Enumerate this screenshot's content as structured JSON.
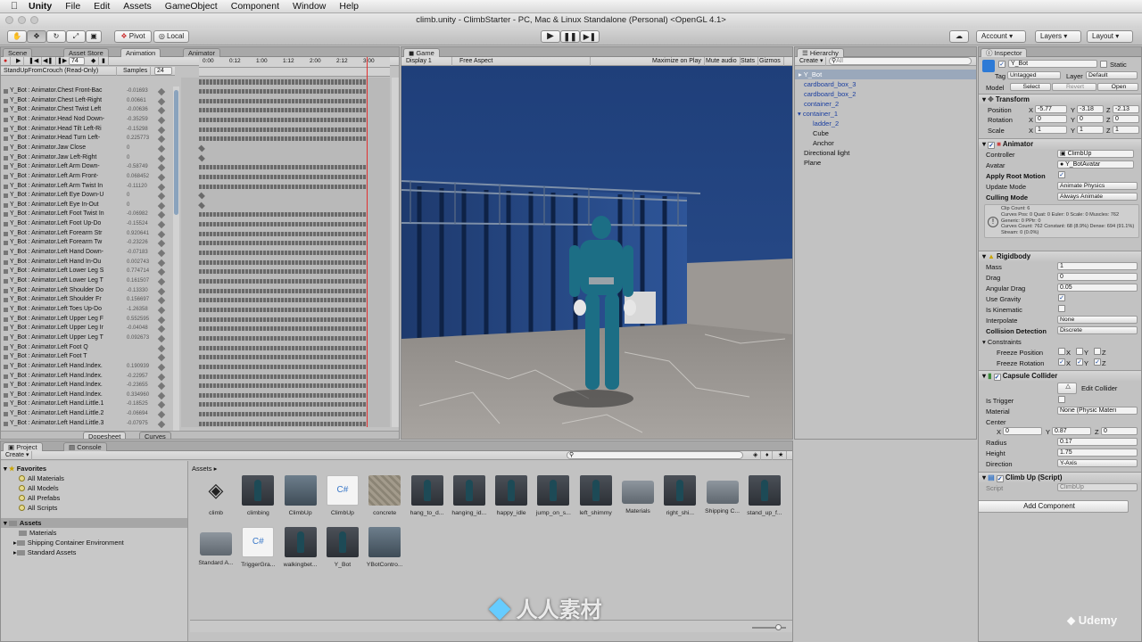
{
  "menubar": {
    "app": "Unity",
    "items": [
      "File",
      "Edit",
      "Assets",
      "GameObject",
      "Component",
      "Window",
      "Help"
    ]
  },
  "window": {
    "title": "climb.unity - ClimbStarter - PC, Mac & Linux Standalone (Personal) <OpenGL 4.1>"
  },
  "toolbar": {
    "pivot": "Pivot",
    "local": "Local",
    "account": "Account",
    "layers": "Layers",
    "layout": "Layout"
  },
  "tabs": {
    "scene": "Scene",
    "asset_store": "Asset Store",
    "animation": "Animation",
    "animator": "Animator",
    "game": "Game",
    "hierarchy": "Hierarchy",
    "inspector": "Inspector",
    "project": "Project",
    "console": "Console"
  },
  "animation": {
    "frame": "74",
    "clip": "StandUpFromCrouch (Read-Only)",
    "samples_label": "Samples",
    "samples": "24",
    "ruler": [
      "0:00",
      "0:12",
      "1:00",
      "1:12",
      "2:00",
      "2:12",
      "3:00"
    ],
    "footer_tabs": [
      "Dopesheet",
      "Curves"
    ],
    "properties": [
      {
        "name": "Y_Bot : Animator.Chest Front-Bac",
        "value": "-0.01693"
      },
      {
        "name": "Y_Bot : Animator.Chest Left-Right",
        "value": "0.00661"
      },
      {
        "name": "Y_Bot : Animator.Chest Twist Left",
        "value": "-0.00636"
      },
      {
        "name": "Y_Bot : Animator.Head Nod Down-",
        "value": "-0.35259"
      },
      {
        "name": "Y_Bot : Animator.Head Tilt Left-Ri",
        "value": "-0.15298"
      },
      {
        "name": "Y_Bot : Animator.Head Turn Left-",
        "value": "0.225773"
      },
      {
        "name": "Y_Bot : Animator.Jaw Close",
        "value": "0"
      },
      {
        "name": "Y_Bot : Animator.Jaw Left-Right",
        "value": "0"
      },
      {
        "name": "Y_Bot : Animator.Left Arm Down-",
        "value": "-0.58749"
      },
      {
        "name": "Y_Bot : Animator.Left Arm Front-",
        "value": "0.068452"
      },
      {
        "name": "Y_Bot : Animator.Left Arm Twist In",
        "value": "-0.11120"
      },
      {
        "name": "Y_Bot : Animator.Left Eye Down-U",
        "value": "0"
      },
      {
        "name": "Y_Bot : Animator.Left Eye In-Out",
        "value": "0"
      },
      {
        "name": "Y_Bot : Animator.Left Foot Twist In",
        "value": "-0.06982"
      },
      {
        "name": "Y_Bot : Animator.Left Foot Up-Do",
        "value": "-0.15524"
      },
      {
        "name": "Y_Bot : Animator.Left Forearm Str",
        "value": "0.920641"
      },
      {
        "name": "Y_Bot : Animator.Left Forearm Tw",
        "value": "-0.23226"
      },
      {
        "name": "Y_Bot : Animator.Left Hand Down-",
        "value": "-0.07183"
      },
      {
        "name": "Y_Bot : Animator.Left Hand In-Ou",
        "value": "0.002743"
      },
      {
        "name": "Y_Bot : Animator.Left Lower Leg S",
        "value": "0.774714"
      },
      {
        "name": "Y_Bot : Animator.Left Lower Leg T",
        "value": "0.161507"
      },
      {
        "name": "Y_Bot : Animator.Left Shoulder Do",
        "value": "-0.13330"
      },
      {
        "name": "Y_Bot : Animator.Left Shoulder Fr",
        "value": "0.156697"
      },
      {
        "name": "Y_Bot : Animator.Left Toes Up-Do",
        "value": "-1.26358"
      },
      {
        "name": "Y_Bot : Animator.Left Upper Leg F",
        "value": "0.552595"
      },
      {
        "name": "Y_Bot : Animator.Left Upper Leg Ir",
        "value": "-0.04048"
      },
      {
        "name": "Y_Bot : Animator.Left Upper Leg T",
        "value": "0.092673"
      },
      {
        "name": "Y_Bot : Animator.Left Foot Q",
        "value": ""
      },
      {
        "name": "Y_Bot : Animator.Left Foot T",
        "value": ""
      },
      {
        "name": "Y_Bot : Animator.Left Hand.Index.",
        "value": "0.190939"
      },
      {
        "name": "Y_Bot : Animator.Left Hand.Index.",
        "value": "-0.22957"
      },
      {
        "name": "Y_Bot : Animator.Left Hand.Index.",
        "value": "-0.23655"
      },
      {
        "name": "Y_Bot : Animator.Left Hand.Index.",
        "value": "0.334960"
      },
      {
        "name": "Y_Bot : Animator.Left Hand.Little.1",
        "value": "-0.18525"
      },
      {
        "name": "Y_Bot : Animator.Left Hand.Little.2",
        "value": "-0.06694"
      },
      {
        "name": "Y_Bot : Animator.Left Hand.Little.3",
        "value": "-0.07975"
      }
    ]
  },
  "game": {
    "display": "Display 1",
    "aspect": "Free Aspect",
    "buttons": [
      "Maximize on Play",
      "Mute audio",
      "Stats",
      "Gizmos"
    ]
  },
  "hierarchy": {
    "create": "Create",
    "search": "All",
    "items": [
      {
        "label": "Y_Bot",
        "selected": true
      },
      {
        "label": "cardboard_box_3",
        "selected": false
      },
      {
        "label": "cardboard_box_2",
        "selected": false
      },
      {
        "label": "container_2",
        "selected": false
      },
      {
        "label": "container_1",
        "selected": false
      },
      {
        "label": "ladder_2",
        "selected": false
      },
      {
        "label": "Cube",
        "selected": false
      },
      {
        "label": "Anchor",
        "selected": false
      },
      {
        "label": "Directional light",
        "selected": false
      },
      {
        "label": "Plane",
        "selected": false
      }
    ]
  },
  "inspector": {
    "object_name": "Y_Bot",
    "static_label": "Static",
    "tag_label": "Tag",
    "tag": "Untagged",
    "layer_label": "Layer",
    "layer": "Default",
    "model_label": "Model",
    "model_buttons": [
      "Select",
      "Revert",
      "Open"
    ],
    "transform": {
      "title": "Transform",
      "position_label": "Position",
      "position": [
        "-5.77",
        "-3.18",
        "-2.13"
      ],
      "rotation_label": "Rotation",
      "rotation": [
        "0",
        "0",
        "0"
      ],
      "scale_label": "Scale",
      "scale": [
        "1",
        "1",
        "1"
      ]
    },
    "animator": {
      "title": "Animator",
      "controller_label": "Controller",
      "controller": "ClimbUp",
      "avatar_label": "Avatar",
      "avatar": "Y_BotAvatar",
      "root_motion_label": "Apply Root Motion",
      "update_mode_label": "Update Mode",
      "update_mode": "Animate Physics",
      "culling_mode_label": "Culling Mode",
      "culling_mode": "Always Animate",
      "info": "Clip Count: 6\nCurves Pos: 0 Quat: 0 Euler: 0 Scale: 0 Muscles: 762 Generic: 0 PPtr: 0\nCurves Count: 762 Constant: 68 (8.9%) Dense: 694 (91.1%) Stream: 0 (0.0%)"
    },
    "rigidbody": {
      "title": "Rigidbody",
      "mass_label": "Mass",
      "mass": "1",
      "drag_label": "Drag",
      "drag": "0",
      "angular_drag_label": "Angular Drag",
      "angular_drag": "0.05",
      "use_gravity_label": "Use Gravity",
      "is_kinematic_label": "Is Kinematic",
      "interpolate_label": "Interpolate",
      "interpolate": "None",
      "collision_label": "Collision Detection",
      "collision": "Discrete",
      "constraints_label": "Constraints",
      "freeze_pos_label": "Freeze Position",
      "freeze_rot_label": "Freeze Rotation"
    },
    "capsule": {
      "title": "Capsule Collider",
      "edit_label": "Edit Collider",
      "is_trigger_label": "Is Trigger",
      "material_label": "Material",
      "material": "None (Physic Materi",
      "center_label": "Center",
      "center": [
        "0",
        "0.87",
        "0"
      ],
      "radius_label": "Radius",
      "radius": "0.17",
      "height_label": "Height",
      "height": "1.75",
      "direction_label": "Direction",
      "direction": "Y-Axis"
    },
    "climb_script": {
      "title": "Climb Up (Script)",
      "script_label": "Script",
      "script": "ClimbUp"
    },
    "add_component": "Add Component"
  },
  "project": {
    "create": "Create",
    "favorites": "Favorites",
    "fav_items": [
      "All Materials",
      "All Models",
      "All Prefabs",
      "All Scripts"
    ],
    "assets_root": "Assets",
    "tree": [
      "Materials",
      "Shipping Container Environment",
      "Standard Assets"
    ],
    "breadcrumb": "Assets",
    "assets": [
      {
        "label": "climb",
        "kind": "unity"
      },
      {
        "label": "climbing",
        "kind": "fig"
      },
      {
        "label": "ClimbUp",
        "kind": "ctrl"
      },
      {
        "label": "ClimbUp",
        "kind": "script"
      },
      {
        "label": "concrete",
        "kind": "concrete"
      },
      {
        "label": "hang_to_d...",
        "kind": "fig"
      },
      {
        "label": "hanging_id...",
        "kind": "fig"
      },
      {
        "label": "happy_idle",
        "kind": "fig"
      },
      {
        "label": "jump_on_s...",
        "kind": "fig"
      },
      {
        "label": "left_shimmy",
        "kind": "fig"
      },
      {
        "label": "Materials",
        "kind": "folder"
      },
      {
        "label": "right_shi...",
        "kind": "fig"
      },
      {
        "label": "Shipping C...",
        "kind": "folder"
      },
      {
        "label": "stand_up_f...",
        "kind": "fig"
      },
      {
        "label": "Standard A...",
        "kind": "folder"
      },
      {
        "label": "TriggerGra...",
        "kind": "script"
      },
      {
        "label": "walkingbet...",
        "kind": "fig"
      },
      {
        "label": "Y_Bot",
        "kind": "fig"
      },
      {
        "label": "YBotContro...",
        "kind": "ctrl"
      }
    ]
  },
  "watermarks": {
    "center": "人人素材",
    "udemy": "Udemy"
  }
}
